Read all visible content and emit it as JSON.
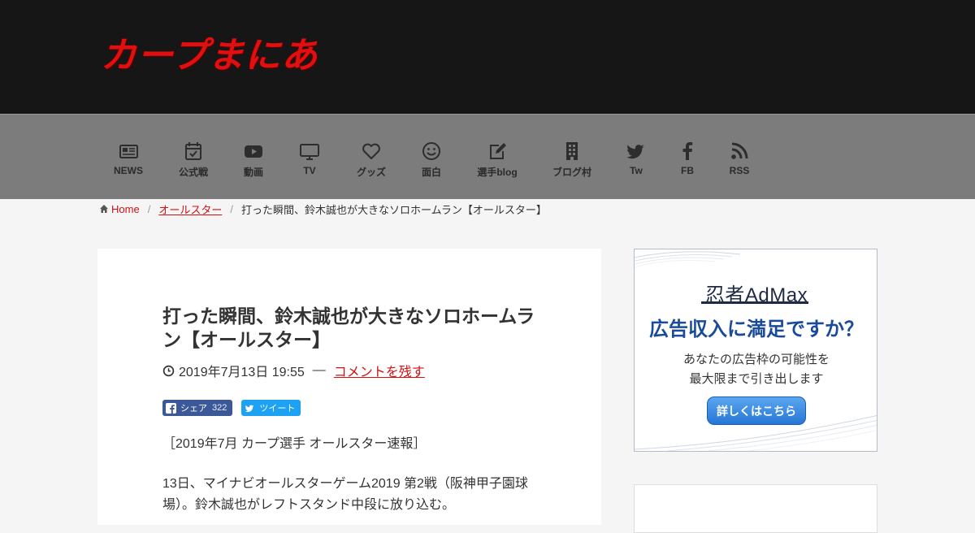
{
  "site": {
    "logo_text": "カープまにあ",
    "logo_color": "#e01010",
    "header_bg": "#161616",
    "nav_bg": "#7c7c7c",
    "accent_link": "#d31111"
  },
  "nav": {
    "items": [
      {
        "label": "NEWS",
        "icon": "newspaper-icon"
      },
      {
        "label": "公式戦",
        "icon": "calendar-check-icon"
      },
      {
        "label": "動画",
        "icon": "youtube-icon"
      },
      {
        "label": "TV",
        "icon": "tv-icon"
      },
      {
        "label": "グッズ",
        "icon": "heart-icon"
      },
      {
        "label": "面白",
        "icon": "smile-icon"
      },
      {
        "label": "選手blog",
        "icon": "edit-icon"
      },
      {
        "label": "ブログ村",
        "icon": "building-icon"
      },
      {
        "label": "Tw",
        "icon": "twitter-icon"
      },
      {
        "label": "FB",
        "icon": "facebook-icon"
      },
      {
        "label": "RSS",
        "icon": "rss-icon"
      }
    ]
  },
  "breadcrumb": {
    "home": "Home",
    "category": "オールスター",
    "current": "打った瞬間、鈴木誠也が大きなソロホームラン【オールスター】"
  },
  "article": {
    "title": "打った瞬間、鈴木誠也が大きなソロホームラン【オールスター】",
    "date": "2019年7月13日 19:55",
    "meta_dash": "—",
    "comment_link": "コメントを残す",
    "share": {
      "facebook_label": "シェア",
      "facebook_count": "322",
      "twitter_label": "ツイート"
    },
    "paragraph1": "［2019年7月 カープ選手 オールスター速報］",
    "paragraph2": "13日、マイナビオールスターゲーム2019 第2戦（阪神甲子園球場）。鈴木誠也がレフトスタンド中段に放り込む。"
  },
  "sidebar_ad": {
    "brand": "忍者AdMax",
    "headline": "広告収入に満足ですか？",
    "sub_line1": "あなたの広告枠の可能性を",
    "sub_line2": "最大限まで引き出します",
    "cta": "詳しくはこちら"
  }
}
